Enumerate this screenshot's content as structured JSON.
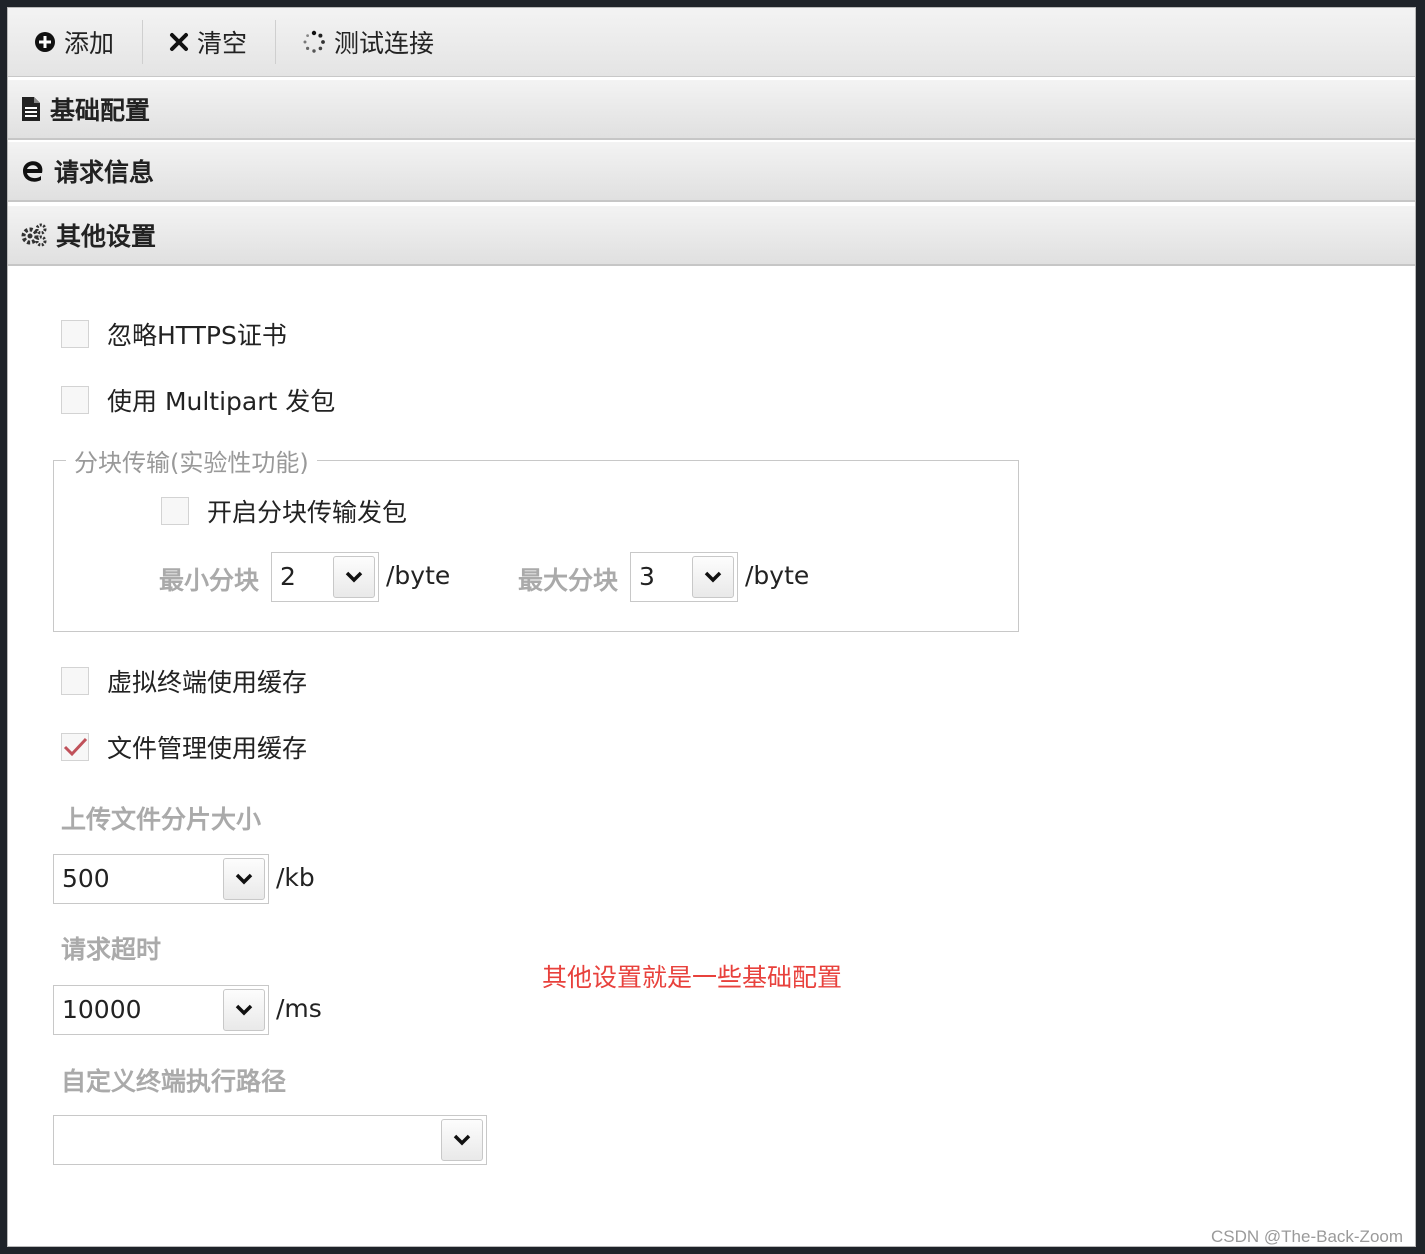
{
  "toolbar": {
    "add_label": "添加",
    "clear_label": "清空",
    "test_label": "测试连接"
  },
  "panels": {
    "basic": "基础配置",
    "request": "请求信息",
    "other": "其他设置"
  },
  "options": {
    "ignore_https": {
      "label": "忽略HTTPS证书",
      "checked": false
    },
    "multipart": {
      "label": "使用 Multipart 发包",
      "checked": false
    },
    "chunk_group_title": "分块传输(实验性功能)",
    "chunk_enable": {
      "label": "开启分块传输发包",
      "checked": false
    },
    "min_chunk": {
      "label": "最小分块",
      "value": "2",
      "unit": "/byte"
    },
    "max_chunk": {
      "label": "最大分块",
      "value": "3",
      "unit": "/byte"
    },
    "terminal_cache": {
      "label": "虚拟终端使用缓存",
      "checked": false
    },
    "file_cache": {
      "label": "文件管理使用缓存",
      "checked": true
    },
    "upload_size": {
      "label": "上传文件分片大小",
      "value": "500",
      "unit": "/kb"
    },
    "timeout": {
      "label": "请求超时",
      "value": "10000",
      "unit": "/ms"
    },
    "terminal_path": {
      "label": "自定义终端执行路径",
      "value": ""
    }
  },
  "annotation": "其他设置就是一些基础配置",
  "watermark": "CSDN @The-Back-Zoom",
  "colors": {
    "annotation": "#e8413c",
    "check_mark": "#c0515a"
  }
}
